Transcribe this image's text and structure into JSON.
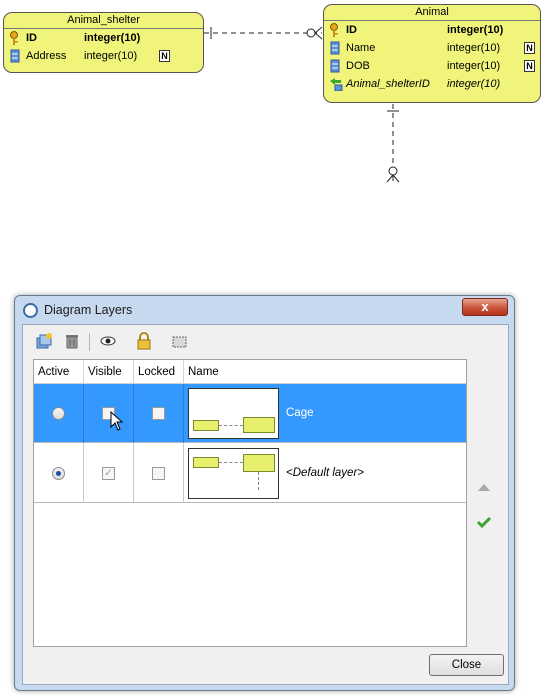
{
  "er": {
    "entities": [
      {
        "title": "Animal_shelter",
        "columns": [
          {
            "name": "ID",
            "type": "integer(10)",
            "pk": true,
            "nullable": false
          },
          {
            "name": "Address",
            "type": "integer(10)",
            "pk": false,
            "nullable": true
          }
        ]
      },
      {
        "title": "Animal",
        "columns": [
          {
            "name": "ID",
            "type": "integer(10)",
            "pk": true,
            "nullable": false
          },
          {
            "name": "Name",
            "type": "integer(10)",
            "pk": false,
            "nullable": true
          },
          {
            "name": "DOB",
            "type": "integer(10)",
            "pk": false,
            "nullable": true
          },
          {
            "name": "Animal_shelterID",
            "type": "integer(10)",
            "pk": false,
            "fk": true,
            "nullable": false
          }
        ]
      }
    ],
    "nullable_badge": "N"
  },
  "dialog": {
    "title": "Diagram Layers",
    "close_glyph": "x",
    "toolbar": [
      {
        "icon": "new-layer-icon"
      },
      {
        "icon": "delete-icon"
      },
      {
        "icon": "visibility-eye-icon"
      },
      {
        "icon": "lock-icon"
      },
      {
        "icon": "select-area-icon"
      }
    ],
    "columns": [
      "Active",
      "Visible",
      "Locked",
      "Name"
    ],
    "rows": [
      {
        "name": "Cage",
        "active": false,
        "visible": false,
        "locked": false,
        "selected": true
      },
      {
        "name": "<Default layer>",
        "active": true,
        "visible": true,
        "locked": false,
        "selected": false
      }
    ],
    "close_button": "Close",
    "colors": {
      "selection": "#3399ff",
      "entity_fill": "#f0f47a",
      "titlebar": "#c7d9ee",
      "close_red": "#c9543c"
    }
  }
}
